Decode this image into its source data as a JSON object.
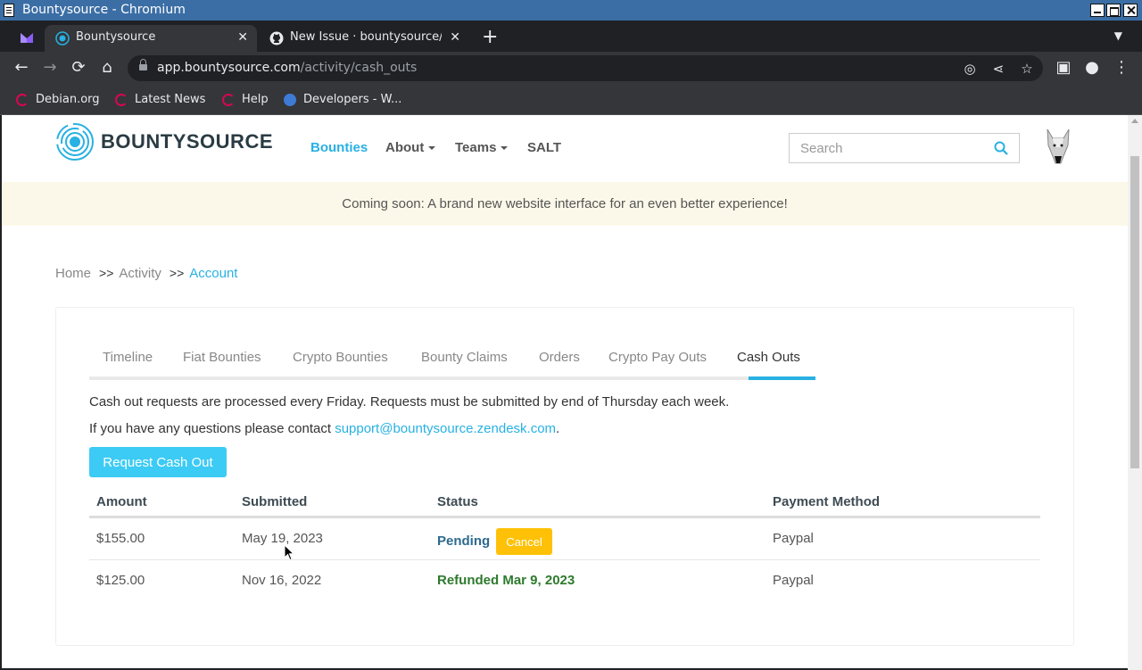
{
  "window": {
    "title": "Bountysource - Chromium"
  },
  "tabs": [
    {
      "label": "Bountysource"
    },
    {
      "label": "New Issue · bountysource/c"
    }
  ],
  "omnibox": {
    "host": "app.bountysource.com",
    "path": "/activity/cash_outs"
  },
  "bookmarks": [
    {
      "label": "Debian.org"
    },
    {
      "label": "Latest News"
    },
    {
      "label": "Help"
    },
    {
      "label": "Developers - W..."
    }
  ],
  "site": {
    "logo_text": "BOUNTYSOURCE",
    "nav": {
      "bounties": "Bounties",
      "about": "About",
      "teams": "Teams",
      "salt": "SALT"
    },
    "search_placeholder": "Search",
    "brand_color": "#28b1e2"
  },
  "banner": "Coming soon: A brand new website interface for an even better experience!",
  "breadcrumb": {
    "home": "Home",
    "sep": ">>",
    "activity": "Activity",
    "current": "Account"
  },
  "page_tabs": [
    "Timeline",
    "Fiat Bounties",
    "Crypto Bounties",
    "Bounty Claims",
    "Orders",
    "Crypto Pay Outs",
    "Cash Outs"
  ],
  "active_tab": "Cash Outs",
  "info": {
    "line1": "Cash out requests are processed every Friday. Requests must be submitted by end of Thursday each week.",
    "line2_prefix": "If you have any questions please contact ",
    "email": "support@bountysource.zendesk.com",
    "line2_suffix": "."
  },
  "request_button": "Request Cash Out",
  "table": {
    "headers": [
      "Amount",
      "Submitted",
      "Status",
      "Payment Method"
    ],
    "rows": [
      {
        "amount": "$155.00",
        "submitted": "May 19, 2023",
        "status": "Pending",
        "action": "Cancel",
        "method": "Paypal"
      },
      {
        "amount": "$125.00",
        "submitted": "Nov 16, 2022",
        "status": "Refunded Mar 9, 2023",
        "method": "Paypal"
      }
    ]
  }
}
